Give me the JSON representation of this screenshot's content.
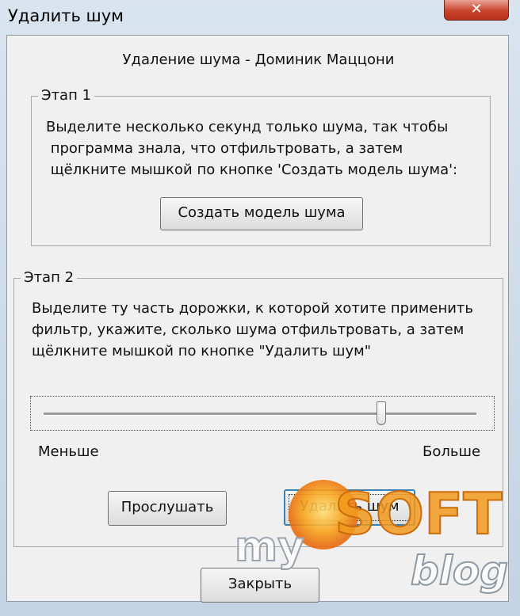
{
  "window": {
    "title": "Удалить шум",
    "close_glyph": "✕"
  },
  "heading": "Удаление шума - Доминик Маццони",
  "step1": {
    "legend": "Этап 1",
    "instructions": "Выделите несколько секунд только шума, так чтобы\n программа знала, что отфильтровать, а затем\n щёлкните мышкой по кнопке 'Создать модель шума':",
    "button": "Создать модель шума"
  },
  "step2": {
    "legend": "Этап 2",
    "instructions": "Выделите ту часть дорожки, к которой хотите применить\nфильтр, укажите, сколько шума отфильтровать, а затем\nщёлкните мышкой по кнопке \"Удалить шум\"",
    "slider_value": 0.78,
    "label_less": "Меньше",
    "label_more": "Больше",
    "preview_button": "Прослушать",
    "remove_button": "Удалить шум"
  },
  "close_button": "Закрыть",
  "watermark": {
    "my": "my",
    "soft": "SOFT",
    "blog": "blog"
  }
}
